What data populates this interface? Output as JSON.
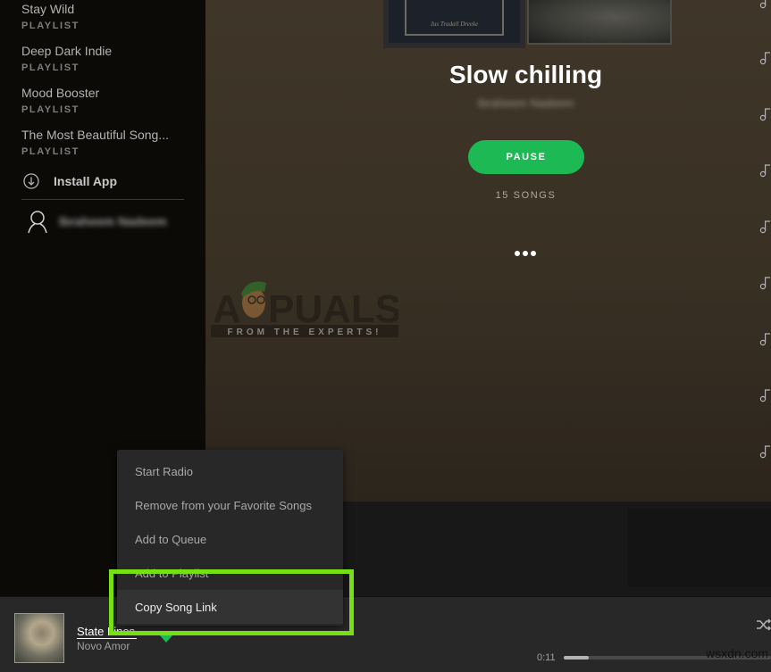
{
  "sidebar": {
    "playlists": [
      {
        "name": "Stay Wild",
        "type": "PLAYLIST"
      },
      {
        "name": "Deep Dark Indie",
        "type": "PLAYLIST"
      },
      {
        "name": "Mood Booster",
        "type": "PLAYLIST"
      },
      {
        "name": "The Most Beautiful Song...",
        "type": "PLAYLIST"
      }
    ],
    "install_app": "Install App",
    "user_name": "Ibraheem Nadeem"
  },
  "main": {
    "playlist_title": "Slow chilling",
    "owner": "Ibraheem Nadeem",
    "pause_label": "PAUSE",
    "songs_count": "15 SONGS",
    "album_caption": "Jus Tradall Dreeke",
    "watermark": {
      "brand": "APPUALS",
      "tagline": "FROM THE EXPERTS!"
    },
    "track_note_count": 9
  },
  "context_menu": {
    "items": [
      {
        "label": "Start Radio"
      },
      {
        "label": "Remove from your Favorite Songs"
      },
      {
        "label": "Add to Queue"
      },
      {
        "label": "Add to Playlist"
      },
      {
        "label": "Copy Song Link"
      }
    ],
    "active_index": 4
  },
  "player": {
    "track_title": "State Lines",
    "artist": "Novo Amor",
    "elapsed": "0:11",
    "progress_percent": 12,
    "shuffle_icon": "shuffle-icon"
  },
  "colors": {
    "accent": "#1db954",
    "highlight_box": "#76e014"
  },
  "site_watermark": "wsxdn.com"
}
